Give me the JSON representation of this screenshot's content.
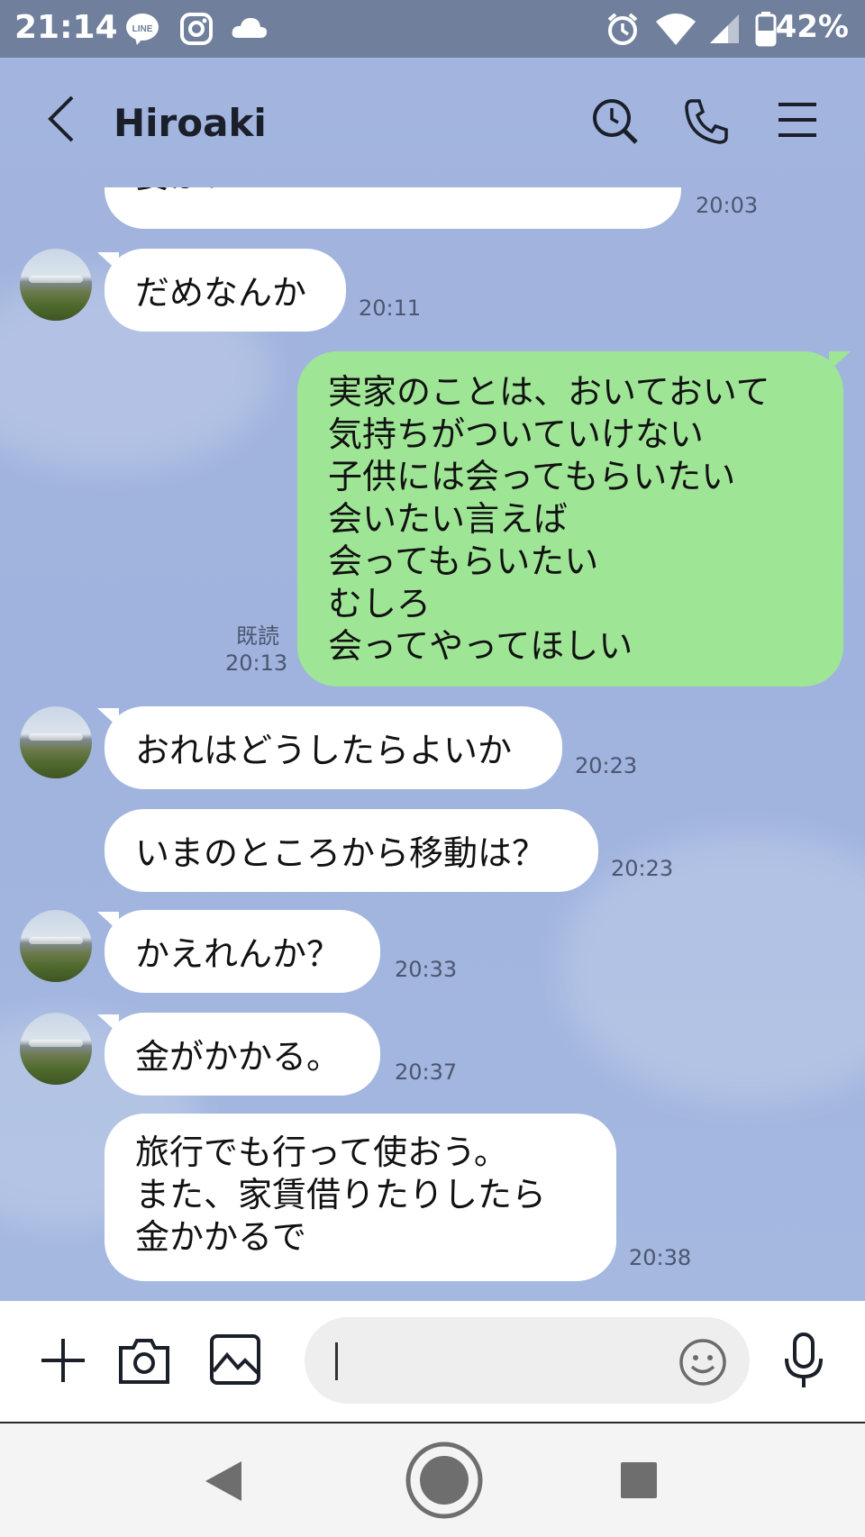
{
  "status_bar": {
    "time": "21:14",
    "battery": "42%"
  },
  "header": {
    "title": "Hiroaki"
  },
  "messages": [
    {
      "side": "them",
      "text": "要か？",
      "time": "20:03"
    },
    {
      "side": "them",
      "text": "だめなんか",
      "time": "20:11"
    },
    {
      "side": "me",
      "text": "実家のことは、おいておいて\n気持ちがついていけない\n子供には会ってもらいたい\n会いたい言えば\n会ってもらいたい\nむしろ\n会ってやってほしい",
      "read": "既読",
      "time": "20:13"
    },
    {
      "side": "them",
      "text": "おれはどうしたらよいか",
      "time": "20:23"
    },
    {
      "side": "them",
      "text": "いまのところから移動は？",
      "time": "20:23"
    },
    {
      "side": "them",
      "text": "かえれんか？",
      "time": "20:33"
    },
    {
      "side": "them",
      "text": "金がかかる。",
      "time": "20:37"
    },
    {
      "side": "them",
      "text": "旅行でも行って使おう。\nまた、家賃借りたりしたら\n金かかるで",
      "time": "20:38"
    }
  ],
  "composer": {
    "placeholder": ""
  },
  "colors": {
    "chat_bg": "#9fb2dc",
    "my_bubble": "#9fe596",
    "their_bubble": "#ffffff",
    "status_bar": "#6f7f9c"
  },
  "icons": [
    "line-icon",
    "instagram-icon",
    "cloud-icon",
    "alarm-icon",
    "wifi-icon",
    "signal-icon",
    "battery-icon",
    "back-icon",
    "search-icon",
    "phone-icon",
    "menu-icon",
    "plus-icon",
    "camera-icon",
    "image-icon",
    "emoji-icon",
    "microphone-icon",
    "nav-back-icon",
    "nav-home-icon",
    "nav-recents-icon"
  ]
}
